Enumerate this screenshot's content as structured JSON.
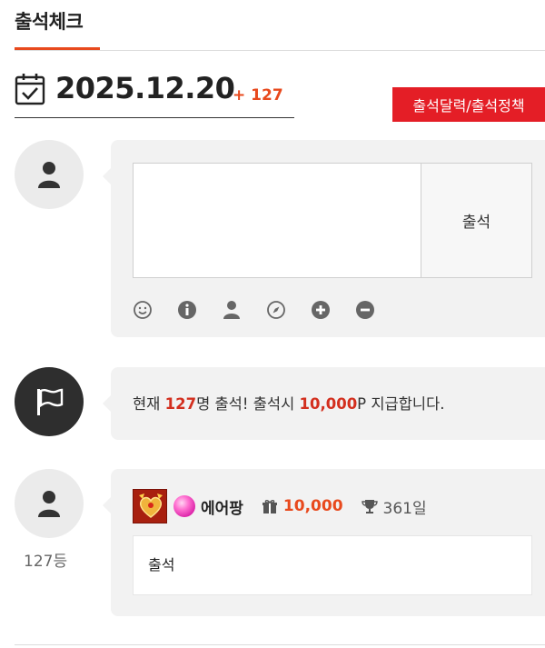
{
  "page": {
    "title": "출석체크"
  },
  "date_block": {
    "date": "2025.12.20",
    "count": "+ 127"
  },
  "policy_button": {
    "label": "출석달력/출석정책"
  },
  "input_card": {
    "textarea_value": "",
    "submit_label": "출석",
    "toolbar_icons": [
      "smile-icon",
      "info-icon",
      "user-icon",
      "compass-icon",
      "plus-circle-icon",
      "minus-circle-icon"
    ]
  },
  "notice": {
    "prefix": "현재 ",
    "count": "127",
    "middle": "명 출석! 출석시 ",
    "points": "10,000",
    "suffix": "P 지급합니다."
  },
  "entry": {
    "rank": "127등",
    "nickname": "에어팡",
    "points": "10,000",
    "days": "361일",
    "comment": "출석"
  },
  "colors": {
    "accent": "#e8491d",
    "policy_button_bg": "#e41e26",
    "highlight": "#d32f1e",
    "card_bg": "#f2f2f2"
  }
}
